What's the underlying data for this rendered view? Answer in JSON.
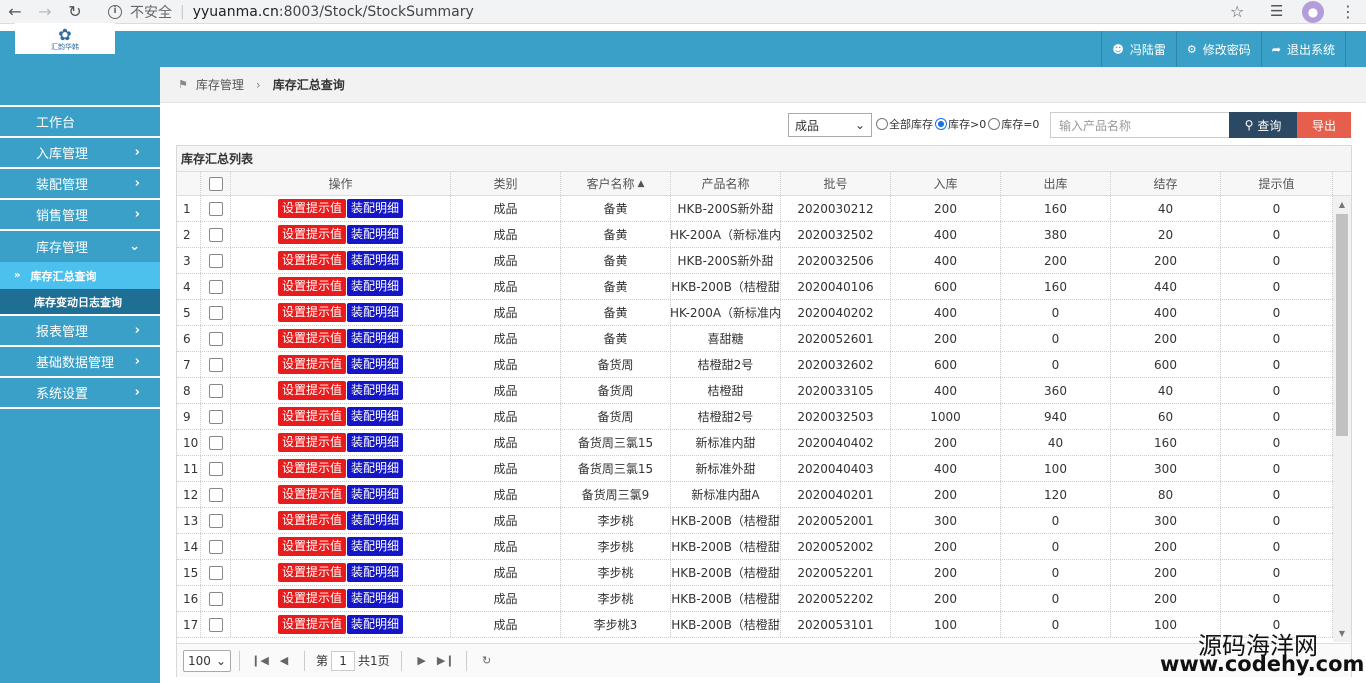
{
  "browser": {
    "security_label": "不安全",
    "url_host": "yyuanma.cn",
    "url_path": ":8003/Stock/StockSummary"
  },
  "header": {
    "logo_text": "汇韵华韩",
    "user_name": "冯陆雷",
    "change_password": "修改密码",
    "logout": "退出系统"
  },
  "sidebar": {
    "items": [
      {
        "label": "工作台"
      },
      {
        "label": "入库管理"
      },
      {
        "label": "装配管理"
      },
      {
        "label": "销售管理"
      },
      {
        "label": "库存管理"
      },
      {
        "label": "库存汇总查询"
      },
      {
        "label": "库存变动日志查询"
      },
      {
        "label": "报表管理"
      },
      {
        "label": "基础数据管理"
      },
      {
        "label": "系统设置"
      }
    ]
  },
  "breadcrumb": {
    "parent": "库存管理",
    "current": "库存汇总查询"
  },
  "toolbar": {
    "category_selected": "成品",
    "radio_all": "全部库存",
    "radio_gt0": "库存>0",
    "radio_eq0": "库存=0",
    "search_placeholder": "输入产品名称",
    "query_label": "查询",
    "export_label": "导出"
  },
  "panel": {
    "title": "库存汇总列表",
    "columns": [
      "操作",
      "类别",
      "客户名称",
      "产品名称",
      "批号",
      "入库",
      "出库",
      "结存",
      "提示值"
    ],
    "btn_set_tip": "设置提示值",
    "btn_assembly": "装配明细",
    "rows": [
      {
        "n": "1",
        "cat": "成品",
        "cust": "备黄",
        "prod": "HKB-200S新外甜",
        "batch": "2020030212",
        "in": "200",
        "out": "160",
        "bal": "40",
        "tip": "0"
      },
      {
        "n": "2",
        "cat": "成品",
        "cust": "备黄",
        "prod": "HK-200A（新标准内",
        "batch": "2020032502",
        "in": "400",
        "out": "380",
        "bal": "20",
        "tip": "0"
      },
      {
        "n": "3",
        "cat": "成品",
        "cust": "备黄",
        "prod": "HKB-200S新外甜",
        "batch": "2020032506",
        "in": "400",
        "out": "200",
        "bal": "200",
        "tip": "0"
      },
      {
        "n": "4",
        "cat": "成品",
        "cust": "备黄",
        "prod": "HKB-200B（桔橙甜",
        "batch": "2020040106",
        "in": "600",
        "out": "160",
        "bal": "440",
        "tip": "0"
      },
      {
        "n": "5",
        "cat": "成品",
        "cust": "备黄",
        "prod": "HK-200A（新标准内",
        "batch": "2020040202",
        "in": "400",
        "out": "0",
        "bal": "400",
        "tip": "0"
      },
      {
        "n": "6",
        "cat": "成品",
        "cust": "备黄",
        "prod": "喜甜糖",
        "batch": "2020052601",
        "in": "200",
        "out": "0",
        "bal": "200",
        "tip": "0"
      },
      {
        "n": "7",
        "cat": "成品",
        "cust": "备货周",
        "prod": "桔橙甜2号",
        "batch": "2020032602",
        "in": "600",
        "out": "0",
        "bal": "600",
        "tip": "0"
      },
      {
        "n": "8",
        "cat": "成品",
        "cust": "备货周",
        "prod": "桔橙甜",
        "batch": "2020033105",
        "in": "400",
        "out": "360",
        "bal": "40",
        "tip": "0"
      },
      {
        "n": "9",
        "cat": "成品",
        "cust": "备货周",
        "prod": "桔橙甜2号",
        "batch": "2020032503",
        "in": "1000",
        "out": "940",
        "bal": "60",
        "tip": "0"
      },
      {
        "n": "10",
        "cat": "成品",
        "cust": "备货周三氯15",
        "prod": "新标准内甜",
        "batch": "2020040402",
        "in": "200",
        "out": "40",
        "bal": "160",
        "tip": "0"
      },
      {
        "n": "11",
        "cat": "成品",
        "cust": "备货周三氯15",
        "prod": "新标准外甜",
        "batch": "2020040403",
        "in": "400",
        "out": "100",
        "bal": "300",
        "tip": "0"
      },
      {
        "n": "12",
        "cat": "成品",
        "cust": "备货周三氯9",
        "prod": "新标准内甜A",
        "batch": "2020040201",
        "in": "200",
        "out": "120",
        "bal": "80",
        "tip": "0"
      },
      {
        "n": "13",
        "cat": "成品",
        "cust": "李步桃",
        "prod": "HKB-200B（桔橙甜",
        "batch": "2020052001",
        "in": "300",
        "out": "0",
        "bal": "300",
        "tip": "0"
      },
      {
        "n": "14",
        "cat": "成品",
        "cust": "李步桃",
        "prod": "HKB-200B（桔橙甜",
        "batch": "2020052002",
        "in": "200",
        "out": "0",
        "bal": "200",
        "tip": "0"
      },
      {
        "n": "15",
        "cat": "成品",
        "cust": "李步桃",
        "prod": "HKB-200B（桔橙甜",
        "batch": "2020052201",
        "in": "200",
        "out": "0",
        "bal": "200",
        "tip": "0"
      },
      {
        "n": "16",
        "cat": "成品",
        "cust": "李步桃",
        "prod": "HKB-200B（桔橙甜",
        "batch": "2020052202",
        "in": "200",
        "out": "0",
        "bal": "200",
        "tip": "0"
      },
      {
        "n": "17",
        "cat": "成品",
        "cust": "李步桃3",
        "prod": "HKB-200B（桔橙甜",
        "batch": "2020053101",
        "in": "100",
        "out": "0",
        "bal": "100",
        "tip": "0"
      }
    ]
  },
  "pager": {
    "page_size": "100",
    "page_prefix": "第",
    "page_number": "1",
    "page_total": "共1页"
  },
  "watermark": {
    "cn": "源码海洋网",
    "url": "www.codehy.com"
  }
}
